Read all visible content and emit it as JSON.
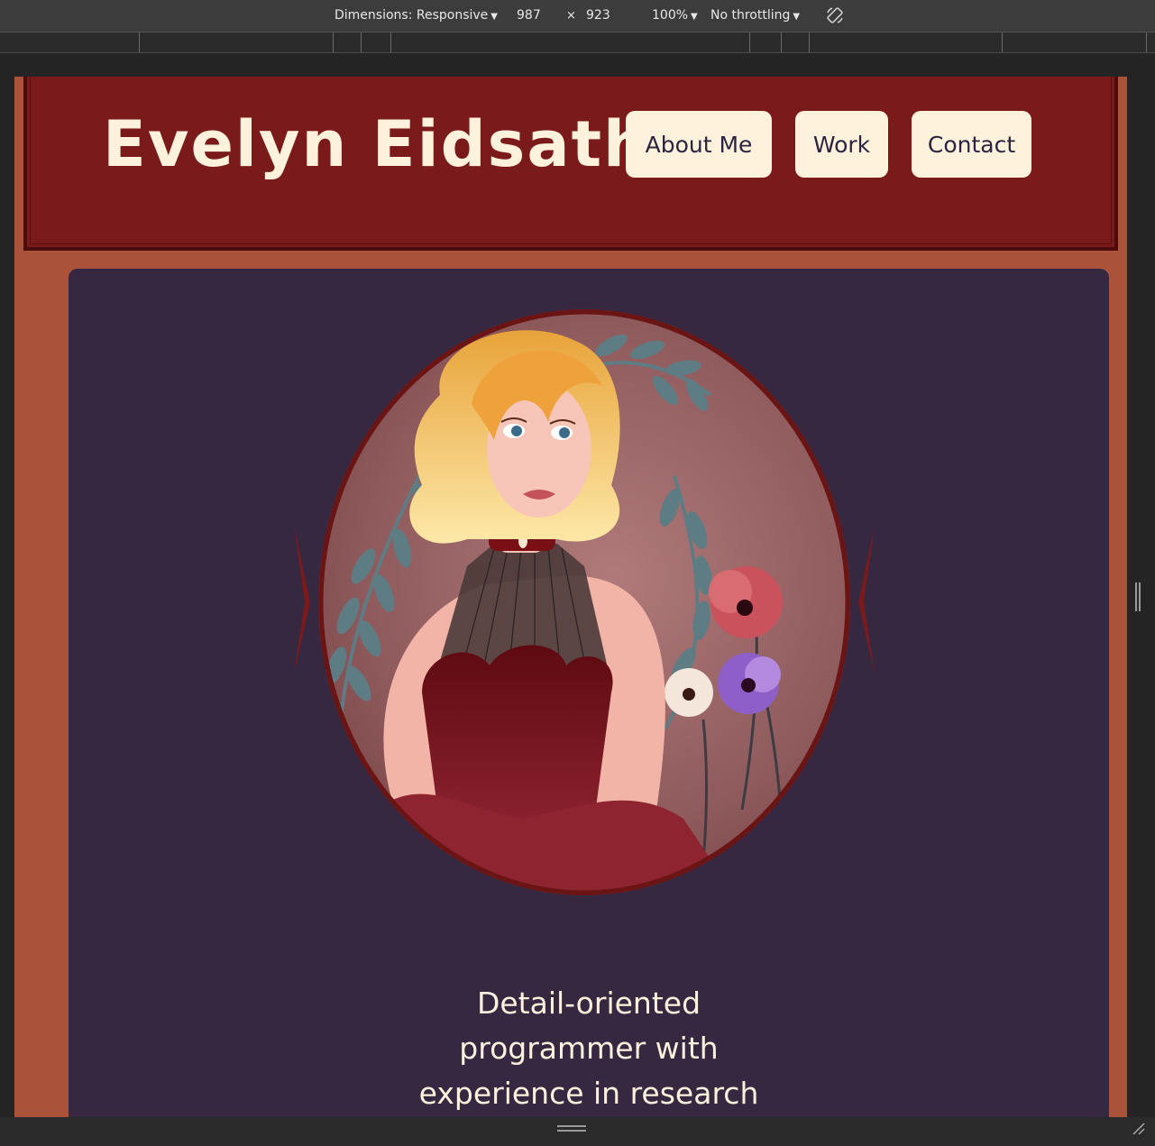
{
  "devtools": {
    "dimensions_label": "Dimensions: Responsive",
    "width": "987",
    "times": "×",
    "height": "923",
    "zoom": "100%",
    "throttling": "No throttling"
  },
  "site": {
    "title": "Evelyn Eidsath",
    "nav": [
      {
        "label": "About Me"
      },
      {
        "label": "Work"
      },
      {
        "label": "Contact"
      }
    ],
    "tagline_lines": [
      "Detail-oriented",
      "programmer with",
      "experience in research"
    ]
  },
  "colors": {
    "page_background": "#ab523a",
    "header_background": "#7a1a1a",
    "card_background": "#372842",
    "text_cream": "#fff2dc",
    "button_text": "#2b2340"
  },
  "icons": [
    "rotate-icon",
    "caret-down-icon",
    "resize-handle-icon",
    "corner-grip-icon"
  ]
}
